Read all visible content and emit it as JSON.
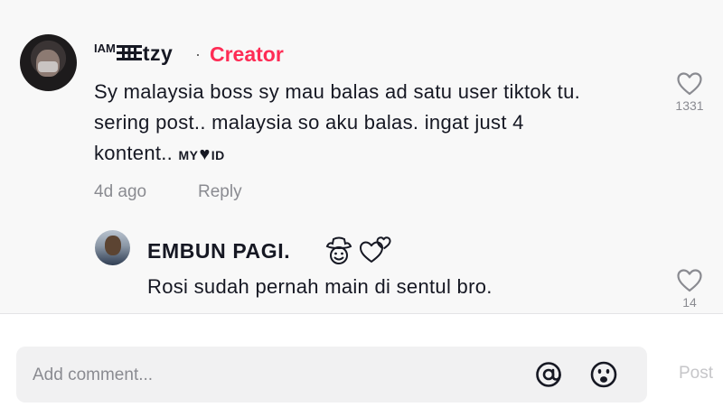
{
  "comment": {
    "username_prefix": "IAM",
    "username_main": "tzy",
    "separator": "·",
    "creator_badge": "Creator",
    "text_line1": "Sy malaysia boss sy mau balas ad satu user tiktok tu.",
    "text_line2": "sering post.. malaysia so aku balas. ingat just 4",
    "text_line3_start": "kontent..",
    "text_line3_my": "MY",
    "text_line3_heart": "♥",
    "text_line3_id": "ID",
    "time": "4d ago",
    "reply_label": "Reply",
    "like_count": "1331"
  },
  "reply": {
    "username": "EMBUN PAGI.",
    "text": "Rosi sudah pernah main di sentul bro.",
    "like_count": "14"
  },
  "composer": {
    "placeholder": "Add comment...",
    "post_label": "Post"
  },
  "icons": {
    "mention": "at-icon",
    "emoji": "emoji-icon",
    "like": "heart-outline-icon",
    "cowboy": "cowboy-emoji-icon",
    "hearts": "two-hearts-emoji-icon"
  },
  "colors": {
    "accent": "#fe2c55",
    "muted": "#8a8b91",
    "text": "#161823"
  }
}
